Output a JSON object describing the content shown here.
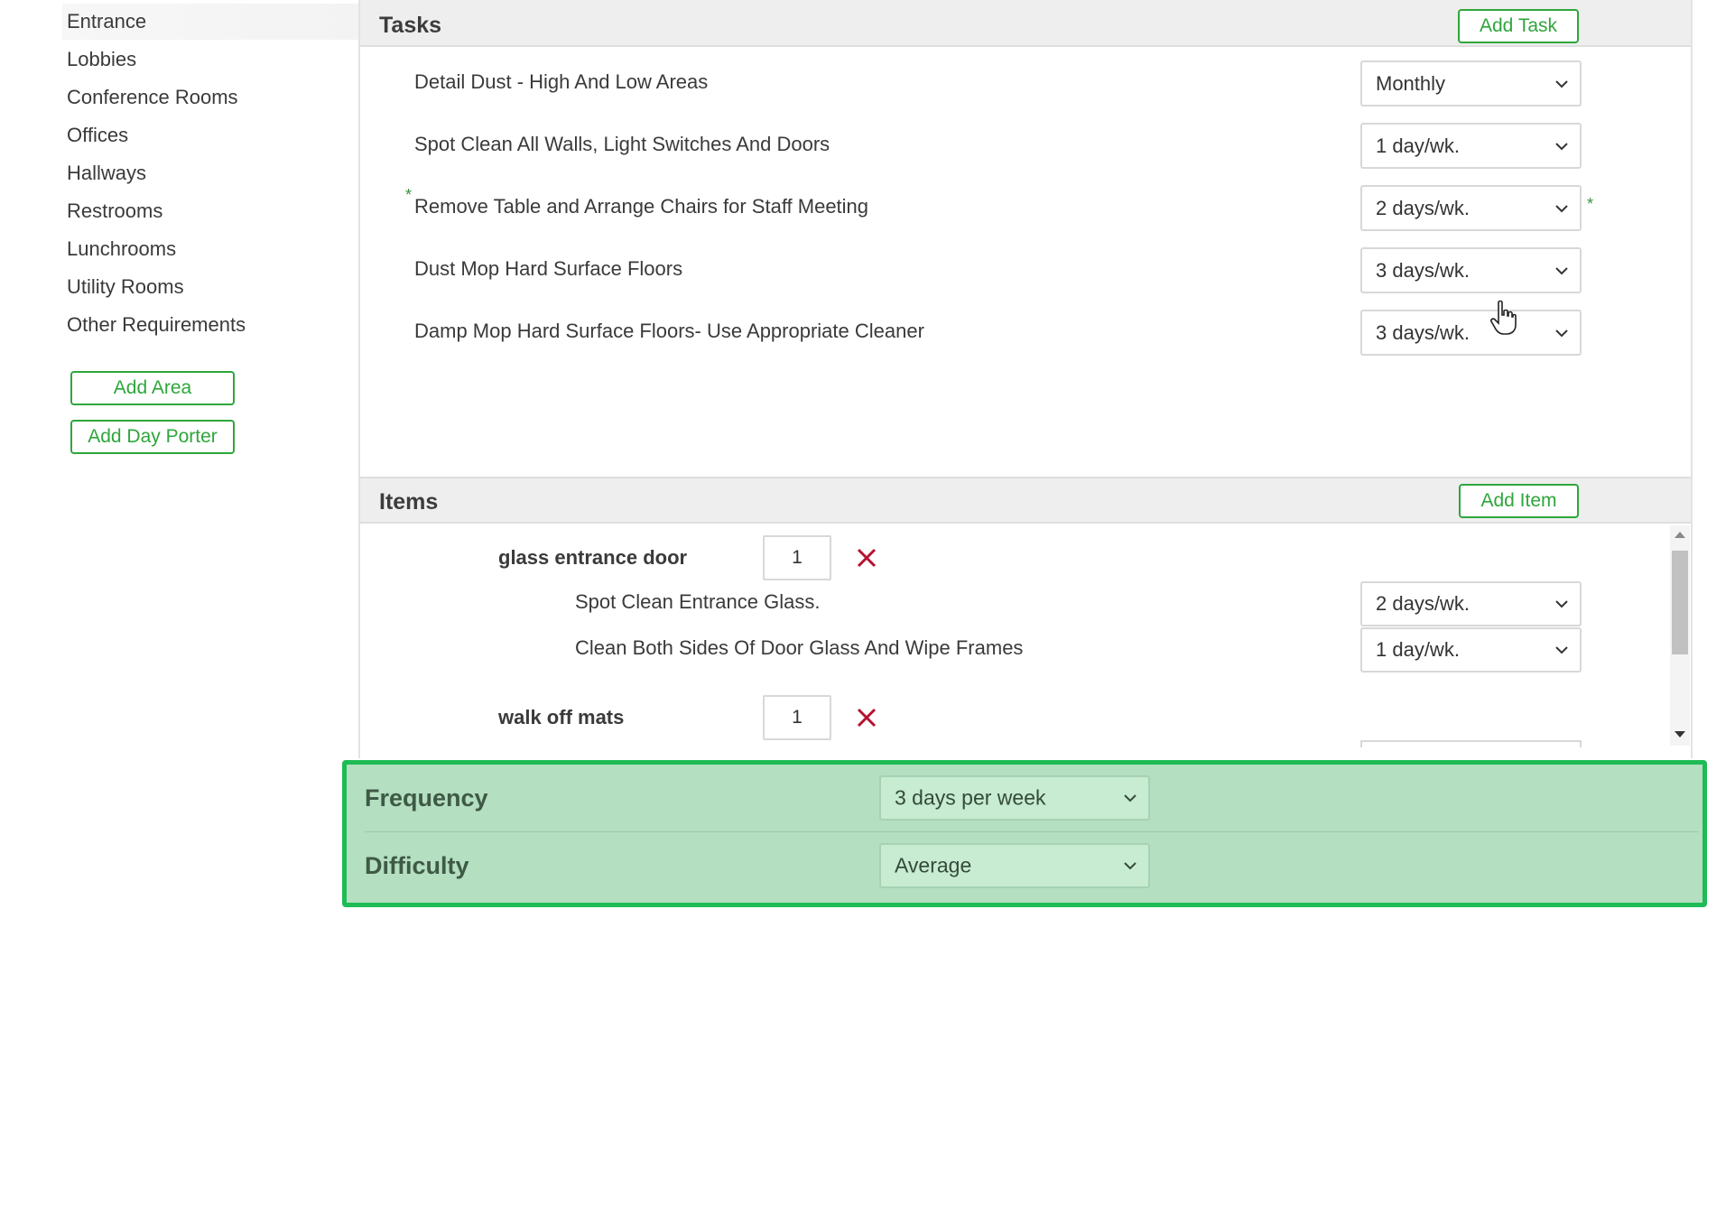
{
  "sidebar": {
    "areas": [
      "Entrance",
      "Lobbies",
      "Conference Rooms",
      "Offices",
      "Hallways",
      "Restrooms",
      "Lunchrooms",
      "Utility Rooms",
      "Other Requirements"
    ],
    "add_area_label": "Add Area",
    "add_day_porter_label": "Add Day Porter"
  },
  "tasks": {
    "title": "Tasks",
    "add_label": "Add Task",
    "rows": [
      {
        "label": "Detail Dust - High And Low Areas",
        "frequency": "Monthly"
      },
      {
        "label": "Spot Clean All Walls, Light Switches And Doors",
        "frequency": "1 day/wk."
      },
      {
        "label": "Remove Table and Arrange Chairs for Staff Meeting",
        "frequency": "2 days/wk.",
        "marker": "*"
      },
      {
        "label": "Dust Mop Hard Surface Floors",
        "frequency": "3 days/wk."
      },
      {
        "label": "Damp Mop Hard Surface Floors- Use Appropriate Cleaner",
        "frequency": "3 days/wk."
      }
    ]
  },
  "items": {
    "title": "Items",
    "add_label": "Add Item",
    "list": [
      {
        "name": "glass entrance door",
        "qty": "1",
        "subtasks": [
          {
            "label": "Spot Clean Entrance Glass.",
            "frequency": "2 days/wk."
          },
          {
            "label": "Clean Both Sides Of Door Glass And Wipe Frames",
            "frequency": "1 day/wk."
          }
        ]
      },
      {
        "name": "walk off mats",
        "qty": "1",
        "subtasks": []
      }
    ]
  },
  "settings": {
    "frequency_label": "Frequency",
    "frequency_value": "3 days per week",
    "difficulty_label": "Difficulty",
    "difficulty_value": "Average"
  },
  "colors": {
    "accent_green": "#2ea63b",
    "highlight_border": "#1fbb55",
    "highlight_fill": "#b4dfc0",
    "remove_red": "#b5122f"
  }
}
